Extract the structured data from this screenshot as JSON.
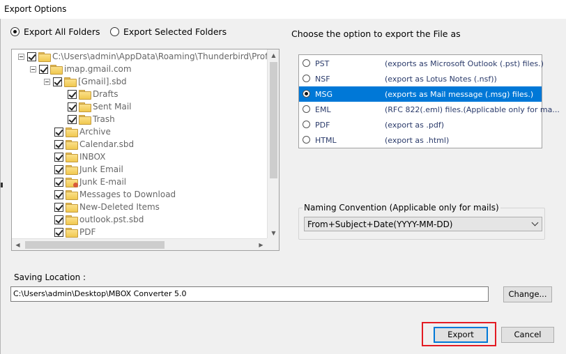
{
  "window": {
    "title": "Export Options"
  },
  "scope": {
    "options": [
      {
        "label": "Export All Folders",
        "selected": true
      },
      {
        "label": "Export Selected Folders",
        "selected": false
      }
    ]
  },
  "tree": {
    "nodes": [
      {
        "label": "C:\\Users\\admin\\AppData\\Roaming\\Thunderbird\\Profiles\\j",
        "checked": true,
        "expander": true,
        "icon": "folder-icon"
      },
      {
        "label": "imap.gmail.com",
        "checked": true,
        "expander": true,
        "icon": "account-folder-icon"
      },
      {
        "label": "[Gmail].sbd",
        "checked": true,
        "expander": true,
        "icon": "folder-icon"
      },
      {
        "label": "Drafts",
        "checked": true,
        "expander": false,
        "icon": "drafts-folder-icon"
      },
      {
        "label": "Sent Mail",
        "checked": true,
        "expander": false,
        "icon": "folder-icon"
      },
      {
        "label": "Trash",
        "checked": true,
        "expander": false,
        "icon": "folder-icon"
      },
      {
        "label": "Archive",
        "checked": true,
        "expander": false,
        "icon": "folder-icon"
      },
      {
        "label": "Calendar.sbd",
        "checked": true,
        "expander": false,
        "icon": "folder-icon"
      },
      {
        "label": "INBOX",
        "checked": true,
        "expander": false,
        "icon": "folder-icon"
      },
      {
        "label": "Junk Email",
        "checked": true,
        "expander": false,
        "icon": "folder-icon"
      },
      {
        "label": "Junk E-mail",
        "checked": true,
        "expander": false,
        "icon": "junk-folder-icon"
      },
      {
        "label": "Messages to Download",
        "checked": true,
        "expander": false,
        "icon": "folder-icon"
      },
      {
        "label": "New-Deleted Items",
        "checked": true,
        "expander": false,
        "icon": "folder-icon"
      },
      {
        "label": "outlook.pst.sbd",
        "checked": true,
        "expander": false,
        "icon": "folder-icon"
      },
      {
        "label": "PDF",
        "checked": true,
        "expander": false,
        "icon": "folder-icon"
      }
    ]
  },
  "export_format": {
    "heading": "Choose the option to export the File as",
    "options": [
      {
        "name": "PST",
        "description": "(exports as Microsoft Outlook (.pst) files.)",
        "selected": false
      },
      {
        "name": "NSF",
        "description": "(export as Lotus Notes (.nsf))",
        "selected": false
      },
      {
        "name": "MSG",
        "description": "(exports as Mail message (.msg) files.)",
        "selected": true
      },
      {
        "name": "EML",
        "description": "(RFC 822(.eml) files.(Applicable only for ma...",
        "selected": false
      },
      {
        "name": "PDF",
        "description": "(export as .pdf)",
        "selected": false
      },
      {
        "name": "HTML",
        "description": "(export as .html)",
        "selected": false
      }
    ]
  },
  "naming": {
    "label": "Naming Convention (Applicable only for mails)",
    "selected": "From+Subject+Date(YYYY-MM-DD)"
  },
  "saving": {
    "label": "Saving Location :",
    "path": "C:\\Users\\admin\\Desktop\\MBOX Converter 5.0",
    "change_label": "Change..."
  },
  "actions": {
    "export_label": "Export",
    "cancel_label": "Cancel"
  },
  "colors": {
    "selection": "#0078d7",
    "highlight_box": "#e31b23",
    "window_bg": "#f0f0f0"
  }
}
